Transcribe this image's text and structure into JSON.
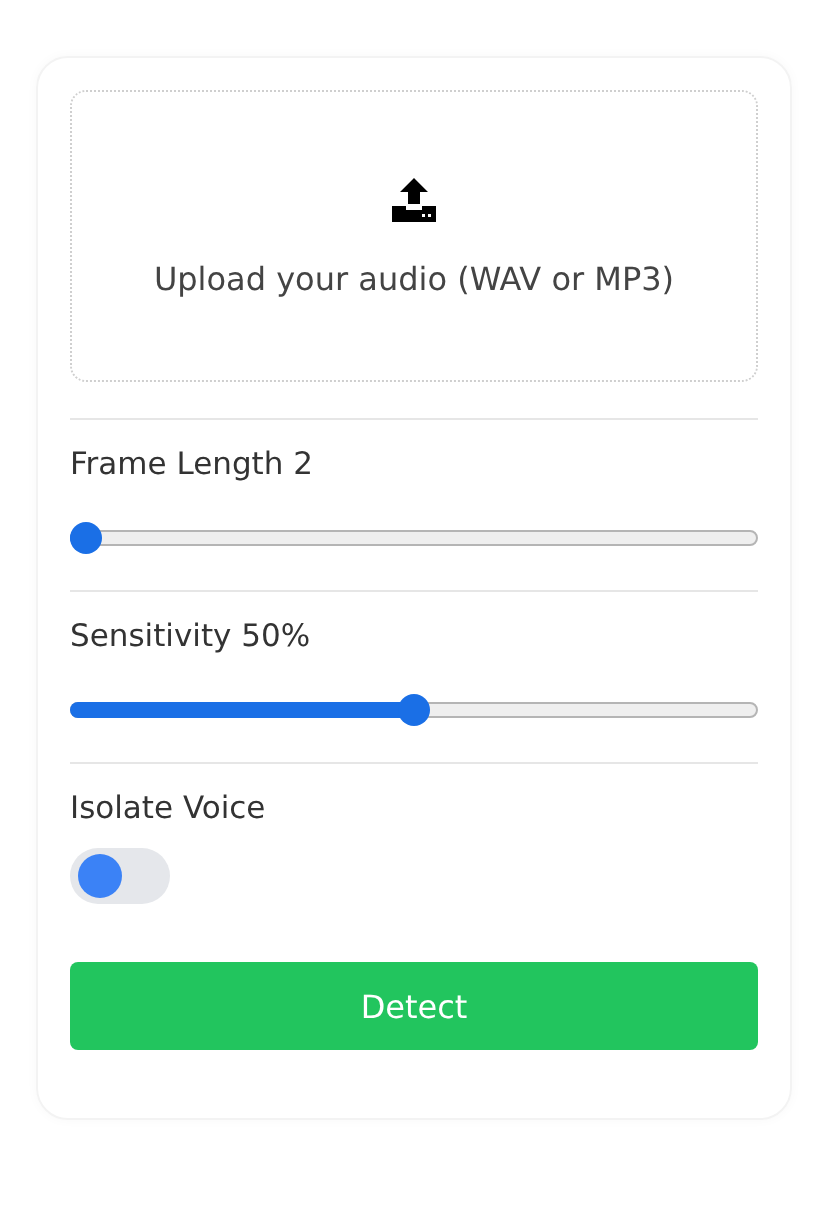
{
  "upload": {
    "label": "Upload your audio (WAV or MP3)"
  },
  "sliders": [
    {
      "label": "Frame Length 2",
      "level": 0
    },
    {
      "label": "Sensitivity 50%",
      "level": 0.5
    }
  ],
  "toggle": {
    "label": "Isolate Voice",
    "on": false
  },
  "button": {
    "label": "Detect"
  }
}
